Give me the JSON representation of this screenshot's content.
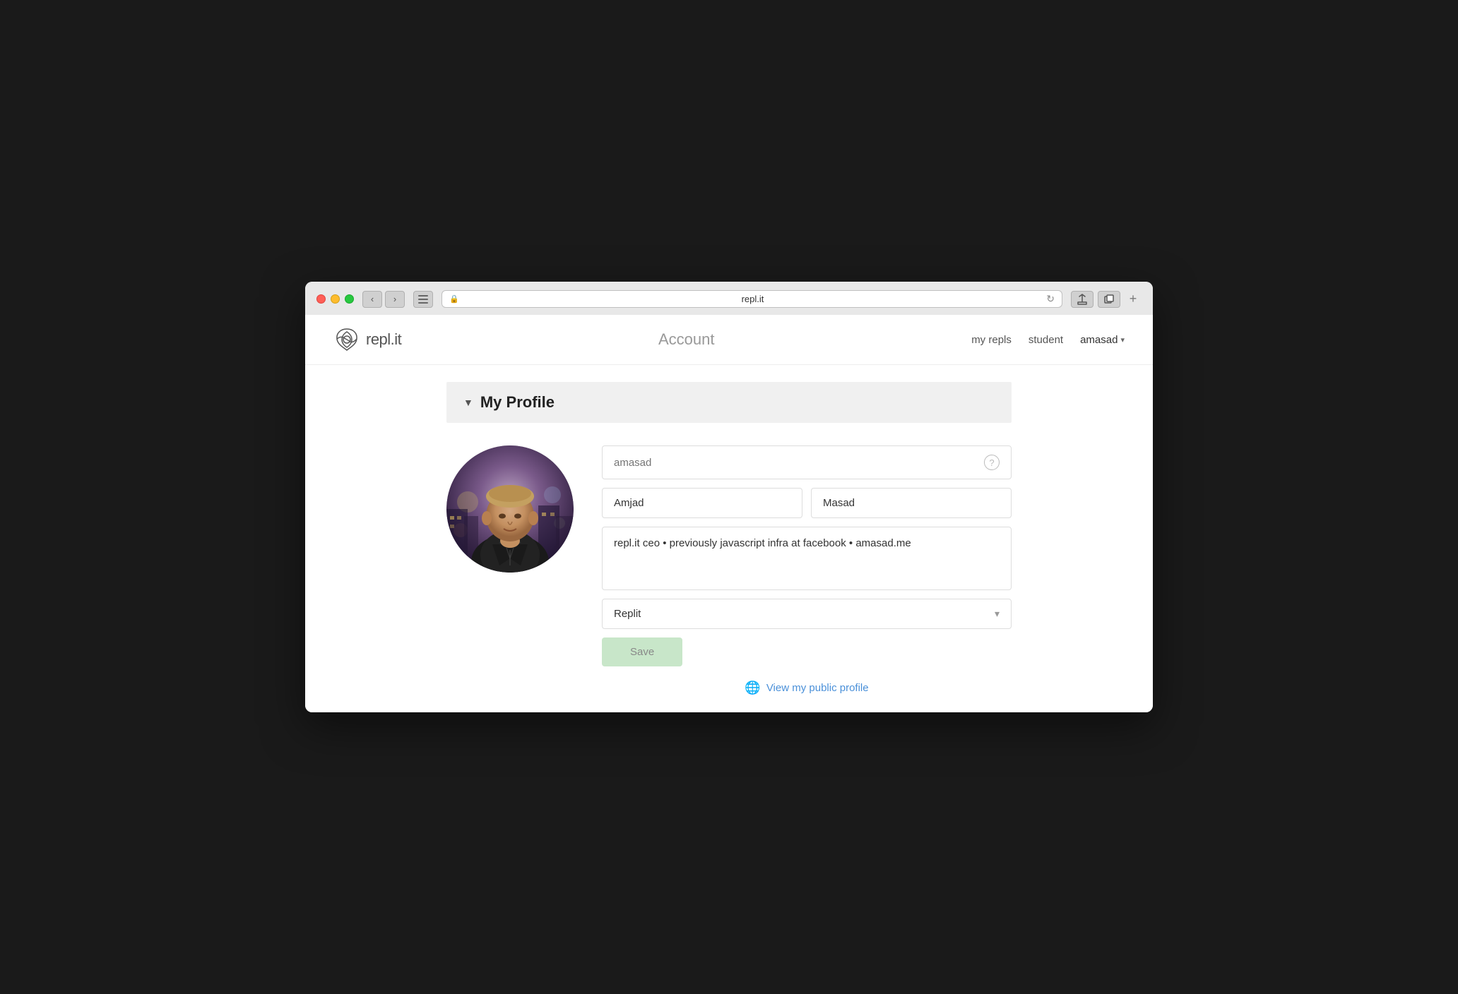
{
  "browser": {
    "url": "repl.it",
    "tab_title": "repl.it"
  },
  "header": {
    "logo_text": "repl.it",
    "page_title": "Account",
    "nav": {
      "my_repls": "my repls",
      "student": "student",
      "username": "amasad"
    }
  },
  "profile_section": {
    "title": "My Profile",
    "collapse_label": "▼",
    "username_placeholder": "amasad",
    "question_mark": "?",
    "first_name": "Amjad",
    "last_name": "Masad",
    "bio": "repl.it ceo • previously javascript infra at facebook • amasad.me",
    "organization": "Replit",
    "save_button": "Save",
    "public_profile_link": "View my public profile"
  }
}
